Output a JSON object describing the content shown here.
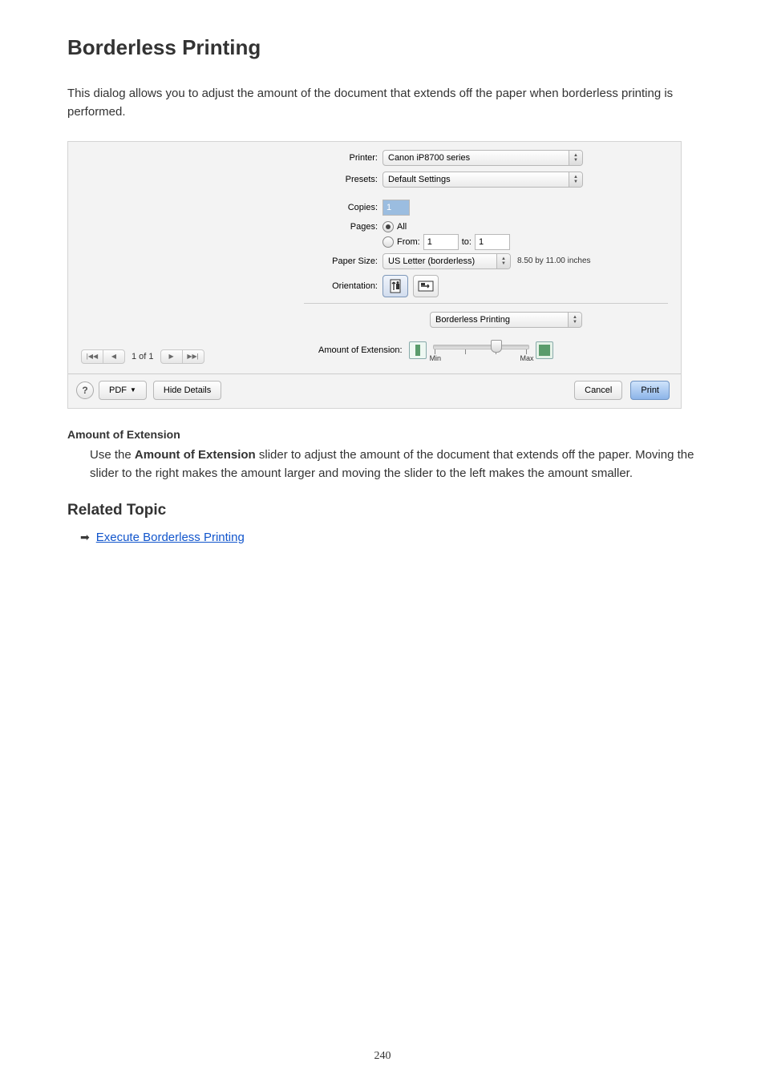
{
  "page_title": "Borderless Printing",
  "intro_text": "This dialog allows you to adjust the amount of the document that extends off the paper when borderless printing is performed.",
  "dialog": {
    "labels": {
      "printer": "Printer:",
      "presets": "Presets:",
      "copies": "Copies:",
      "pages": "Pages:",
      "from": "From:",
      "to": "to:",
      "paper_size": "Paper Size:",
      "orientation": "Orientation:",
      "section_popup": "Borderless Printing",
      "extension": "Amount of Extension:",
      "min": "Min",
      "max": "Max"
    },
    "values": {
      "printer": "Canon iP8700 series",
      "presets": "Default Settings",
      "copies": "1",
      "pages_all": "All",
      "from": "1",
      "to": "1",
      "paper_size": "US Letter (borderless)",
      "paper_size_dim": "8.50 by 11.00 inches"
    },
    "nav": {
      "page_count": "1 of 1"
    },
    "footer": {
      "pdf": "PDF",
      "hide_details": "Hide Details",
      "cancel": "Cancel",
      "print": "Print"
    }
  },
  "definition": {
    "term": "Amount of Extension",
    "body_before": "Use the ",
    "body_bold": "Amount of Extension",
    "body_after": " slider to adjust the amount of the document that extends off the paper. Moving the slider to the right makes the amount larger and moving the slider to the left makes the amount smaller."
  },
  "related": {
    "heading": "Related Topic",
    "link_text": "Execute Borderless Printing"
  },
  "page_number": "240"
}
